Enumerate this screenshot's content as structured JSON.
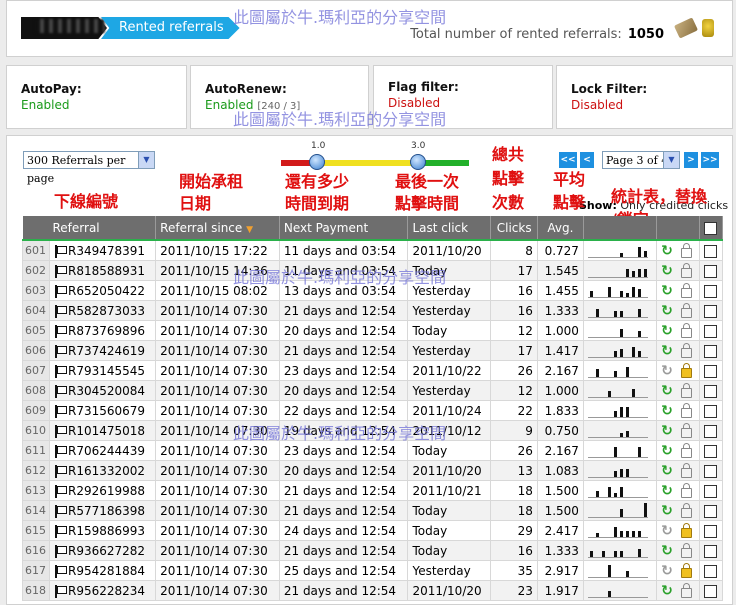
{
  "header": {
    "breadcrumb_current": "Rented referrals",
    "total_label": "Total number of rented referrals:",
    "total_value": "1050"
  },
  "watermark": "此圖屬於牛.瑪利亞的分享空間",
  "filters": [
    {
      "title": "AutoPay:",
      "value": "Enabled",
      "extra": ""
    },
    {
      "title": "AutoRenew:",
      "value": "Enabled",
      "extra": "[240 / 3]"
    },
    {
      "title": "Flag filter:",
      "value": "Disabled",
      "extra": ""
    },
    {
      "title": "Lock Filter:",
      "value": "Disabled",
      "extra": ""
    }
  ],
  "controls": {
    "per_page": "300 Referrals per page",
    "slider_low": "1.0",
    "slider_high": "3.0",
    "page_select": "Page 3 of 4",
    "show_label": "Show:",
    "show_value": "Only credited clicks",
    "pager": {
      "first": "<<",
      "prev": "<",
      "next": ">",
      "last": ">>"
    }
  },
  "annotations": {
    "referral": "下線編號",
    "since_1": "開始承租",
    "since_2": "日期",
    "next_1": "還有多少",
    "next_2": "時間到期",
    "last_1": "最後一次",
    "last_2": "點擊時間",
    "clicks_1": "總共",
    "clicks_2": "點擊",
    "clicks_3": "次數",
    "avg_1": "平均",
    "avg_2": "點擊",
    "stats_1": "統計表，替換",
    "stats_2": "/鎖定"
  },
  "table": {
    "columns": [
      "Referral",
      "Referral since",
      "Next Payment",
      "Last click",
      "Clicks",
      "Avg."
    ],
    "rows": [
      {
        "idx": "601",
        "id": "R349478391",
        "since": "2011/10/15 17:22",
        "next": "11 days and 03:54",
        "last": "2011/10/20",
        "clicks": "8",
        "avg": "0.727",
        "spark": [
          0,
          0,
          0,
          0,
          0,
          2,
          0,
          0,
          5,
          3
        ],
        "locked": false,
        "recycle": true
      },
      {
        "idx": "602",
        "id": "R818588931",
        "since": "2011/10/15 14:36",
        "next": "11 days and 03:54",
        "last": "Today",
        "clicks": "17",
        "avg": "1.545",
        "spark": [
          0,
          0,
          0,
          0,
          0,
          0,
          4,
          3,
          4,
          4
        ],
        "locked": false,
        "recycle": true
      },
      {
        "idx": "603",
        "id": "R652050422",
        "since": "2011/10/15 08:02",
        "next": "13 days and 03:54",
        "last": "Yesterday",
        "clicks": "16",
        "avg": "1.455",
        "spark": [
          3,
          0,
          0,
          5,
          0,
          3,
          2,
          5,
          4,
          0
        ],
        "locked": false,
        "recycle": true
      },
      {
        "idx": "604",
        "id": "R582873033",
        "since": "2011/10/14 07:30",
        "next": "21 days and 12:54",
        "last": "Yesterday",
        "clicks": "16",
        "avg": "1.333",
        "spark": [
          0,
          4,
          0,
          0,
          3,
          3,
          0,
          0,
          4,
          0
        ],
        "locked": false,
        "recycle": true
      },
      {
        "idx": "605",
        "id": "R873769896",
        "since": "2011/10/14 07:30",
        "next": "20 days and 12:54",
        "last": "Today",
        "clicks": "12",
        "avg": "1.000",
        "spark": [
          0,
          0,
          0,
          0,
          0,
          4,
          0,
          0,
          3,
          0
        ],
        "locked": false,
        "recycle": true
      },
      {
        "idx": "606",
        "id": "R737424619",
        "since": "2011/10/14 07:30",
        "next": "21 days and 12:54",
        "last": "Yesterday",
        "clicks": "17",
        "avg": "1.417",
        "spark": [
          0,
          0,
          0,
          0,
          3,
          4,
          0,
          5,
          3,
          0
        ],
        "locked": false,
        "recycle": true
      },
      {
        "idx": "607",
        "id": "R793145545",
        "since": "2011/10/14 07:30",
        "next": "23 days and 12:54",
        "last": "2011/10/22",
        "clicks": "26",
        "avg": "2.167",
        "spark": [
          0,
          4,
          0,
          0,
          3,
          0,
          5,
          0,
          0,
          0
        ],
        "locked": true,
        "recycle": false
      },
      {
        "idx": "608",
        "id": "R304520084",
        "since": "2011/10/14 07:30",
        "next": "20 days and 12:54",
        "last": "Yesterday",
        "clicks": "12",
        "avg": "1.000",
        "spark": [
          0,
          0,
          0,
          3,
          0,
          0,
          0,
          4,
          0,
          0
        ],
        "locked": false,
        "recycle": true
      },
      {
        "idx": "609",
        "id": "R731560679",
        "since": "2011/10/14 07:30",
        "next": "22 days and 12:54",
        "last": "2011/10/24",
        "clicks": "22",
        "avg": "1.833",
        "spark": [
          0,
          0,
          0,
          0,
          3,
          5,
          5,
          0,
          0,
          0
        ],
        "locked": false,
        "recycle": true
      },
      {
        "idx": "610",
        "id": "R101475018",
        "since": "2011/10/14 07:30",
        "next": "19 days and 12:54",
        "last": "2011/10/12",
        "clicks": "9",
        "avg": "0.750",
        "spark": [
          0,
          0,
          0,
          0,
          0,
          2,
          3,
          0,
          0,
          0
        ],
        "locked": false,
        "recycle": true
      },
      {
        "idx": "611",
        "id": "R706244439",
        "since": "2011/10/14 07:30",
        "next": "23 days and 12:54",
        "last": "Today",
        "clicks": "26",
        "avg": "2.167",
        "spark": [
          0,
          0,
          0,
          0,
          5,
          0,
          0,
          0,
          5,
          0
        ],
        "locked": false,
        "recycle": true
      },
      {
        "idx": "612",
        "id": "R161332002",
        "since": "2011/10/14 07:30",
        "next": "20 days and 12:54",
        "last": "2011/10/20",
        "clicks": "13",
        "avg": "1.083",
        "spark": [
          0,
          0,
          0,
          0,
          3,
          4,
          4,
          0,
          0,
          0
        ],
        "locked": false,
        "recycle": true
      },
      {
        "idx": "613",
        "id": "R292619988",
        "since": "2011/10/14 07:30",
        "next": "21 days and 12:54",
        "last": "2011/10/21",
        "clicks": "18",
        "avg": "1.500",
        "spark": [
          0,
          3,
          0,
          5,
          2,
          5,
          0,
          0,
          0,
          0
        ],
        "locked": false,
        "recycle": true
      },
      {
        "idx": "614",
        "id": "R577186398",
        "since": "2011/10/14 07:30",
        "next": "21 days and 12:54",
        "last": "Today",
        "clicks": "18",
        "avg": "1.500",
        "spark": [
          0,
          0,
          0,
          0,
          0,
          4,
          0,
          0,
          0,
          7
        ],
        "locked": false,
        "recycle": true
      },
      {
        "idx": "615",
        "id": "R159886993",
        "since": "2011/10/14 07:30",
        "next": "24 days and 12:54",
        "last": "Today",
        "clicks": "29",
        "avg": "2.417",
        "spark": [
          0,
          2,
          0,
          0,
          5,
          3,
          3,
          3,
          3,
          0
        ],
        "locked": true,
        "recycle": false
      },
      {
        "idx": "616",
        "id": "R936627282",
        "since": "2011/10/14 07:30",
        "next": "21 days and 12:54",
        "last": "Today",
        "clicks": "16",
        "avg": "1.333",
        "spark": [
          3,
          0,
          3,
          0,
          3,
          3,
          0,
          0,
          4,
          0
        ],
        "locked": false,
        "recycle": true
      },
      {
        "idx": "617",
        "id": "R954281884",
        "since": "2011/10/14 07:30",
        "next": "25 days and 12:54",
        "last": "Yesterday",
        "clicks": "35",
        "avg": "2.917",
        "spark": [
          0,
          0,
          0,
          6,
          0,
          0,
          3,
          0,
          0,
          0
        ],
        "locked": true,
        "recycle": false
      },
      {
        "idx": "618",
        "id": "R956228234",
        "since": "2011/10/14 07:30",
        "next": "21 days and 12:54",
        "last": "2011/10/20",
        "clicks": "23",
        "avg": "1.917",
        "spark": [
          0,
          0,
          0,
          3,
          0,
          0,
          0,
          0,
          0,
          0
        ],
        "locked": false,
        "recycle": true
      }
    ]
  }
}
